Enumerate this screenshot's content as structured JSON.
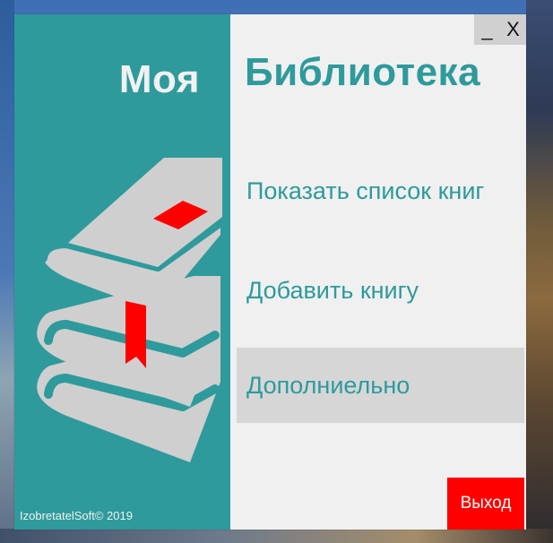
{
  "app": {
    "title_left": "Моя",
    "title_right": "Библиотека",
    "copyright": "IzobretatelSoft© 2019"
  },
  "window_controls": {
    "minimize": "_",
    "close": "X"
  },
  "menu": {
    "items": [
      {
        "label": "Показать список книг"
      },
      {
        "label": "Добавить книгу"
      },
      {
        "label": "Дополниельно"
      }
    ]
  },
  "exit_button": {
    "label": "Выход"
  },
  "colors": {
    "teal": "#2e9a9c",
    "panel": "#f0f0f0",
    "exit": "#ff0000",
    "highlight": "#d6d6d6",
    "books": "#cfcfcf",
    "bookmark": "#ff0000"
  },
  "icons": {
    "books": "books-icon",
    "bookmark": "bookmark-icon"
  }
}
